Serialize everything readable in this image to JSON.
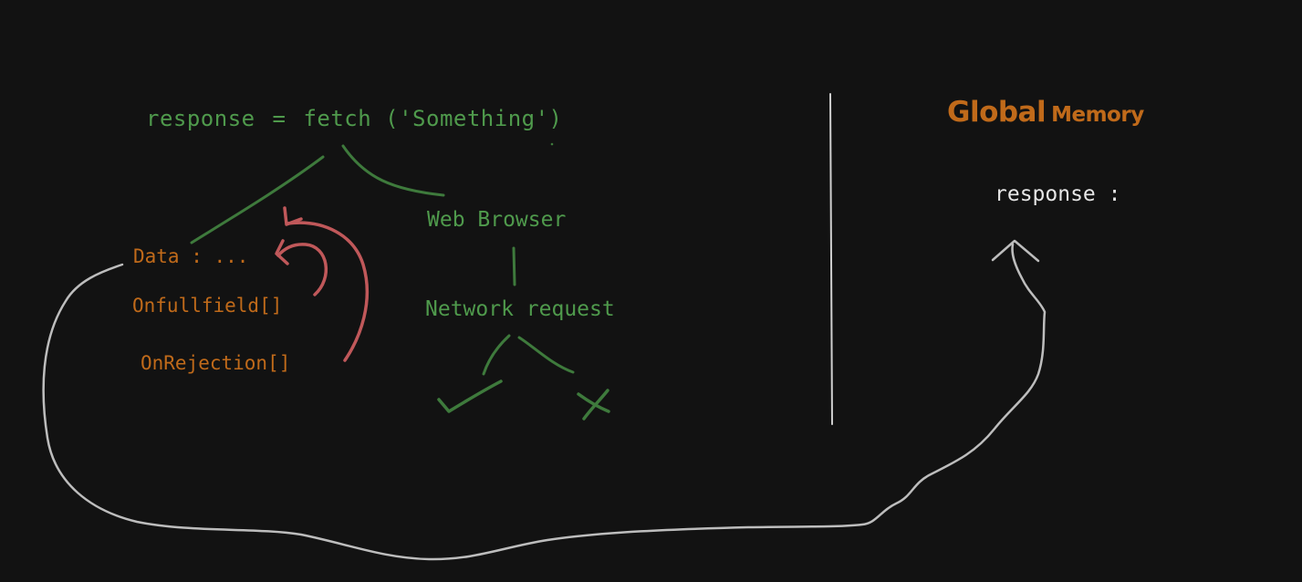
{
  "diagram": {
    "fetch_statement": {
      "variable": "response",
      "operator": "=",
      "call": "fetch ('Something')"
    },
    "web_browser_label": "Web Browser",
    "network_request_label": "Network request",
    "promise_object": {
      "data_label": "Data : ...",
      "onfulfilled_label": "Onfullfield[]",
      "onrejection_label": "OnRejection[]"
    },
    "global_memory": {
      "title_main": "Global",
      "title_sub": "Memory",
      "variable_label": "response :"
    },
    "outcome_icons": [
      "checkmark-icon",
      "cross-icon"
    ]
  },
  "colors": {
    "background": "#121212",
    "green": "#4f9a4c",
    "orange": "#c06a1a",
    "red_arrow": "#c0585a",
    "white": "#e6e6e6",
    "gray_curve": "#bdbdbd"
  }
}
